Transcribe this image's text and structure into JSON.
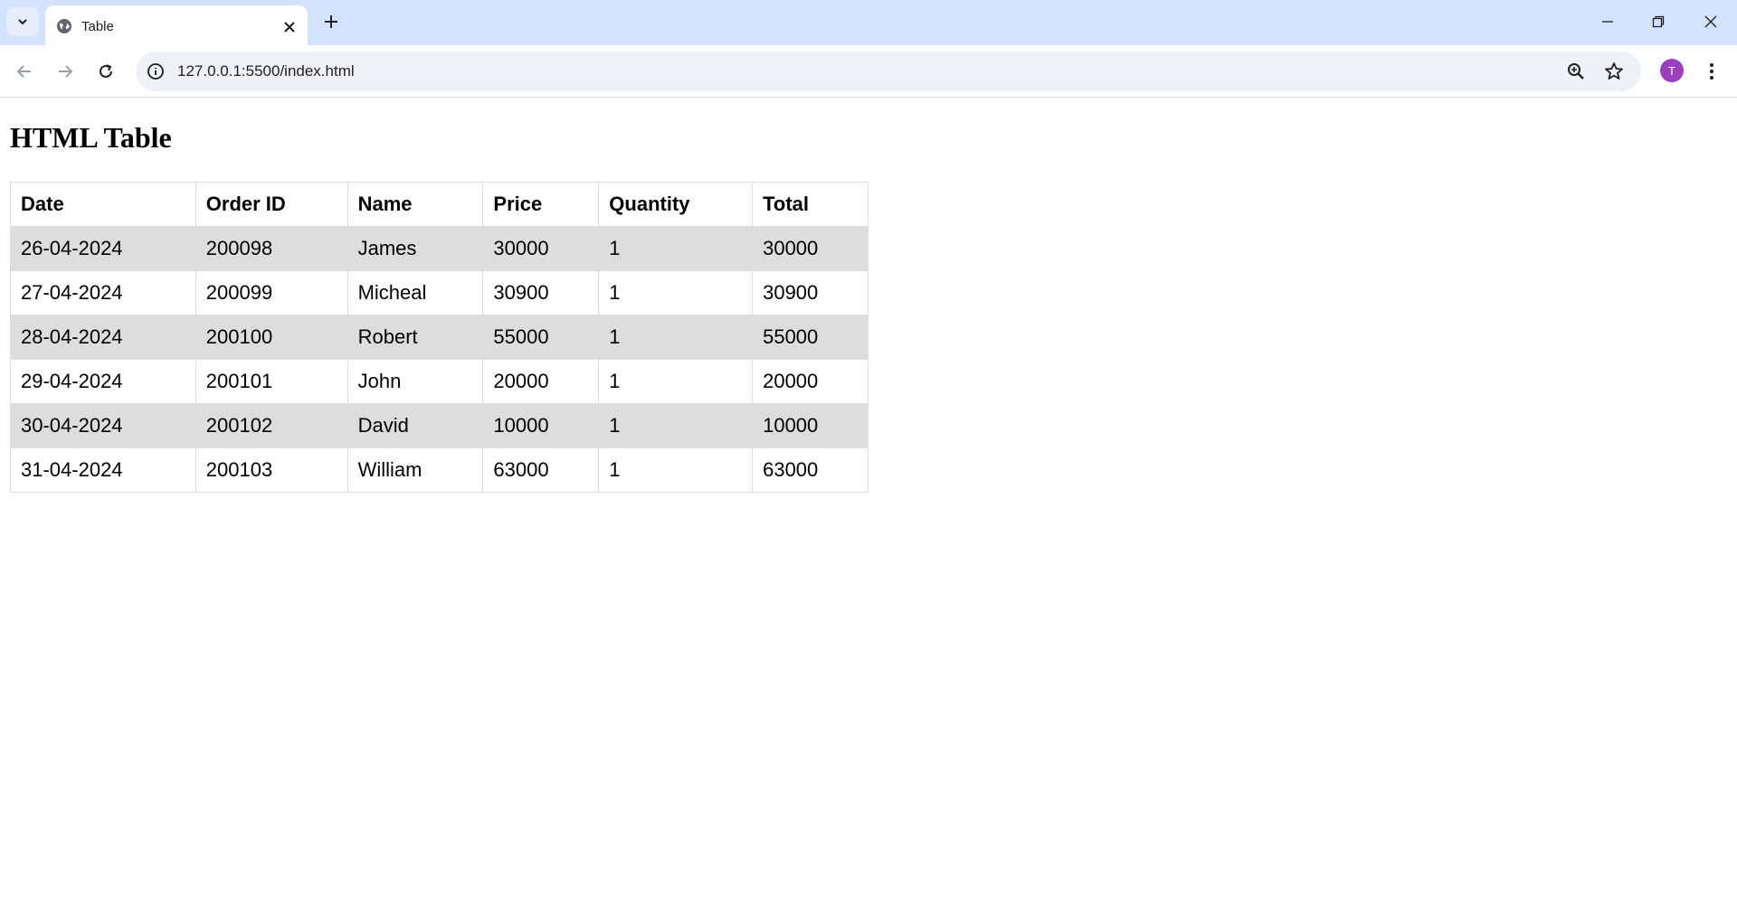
{
  "browser": {
    "tab_title": "Table",
    "url": "127.0.0.1:5500/index.html",
    "profile_initial": "T"
  },
  "page": {
    "heading": "HTML Table",
    "table": {
      "headers": [
        "Date",
        "Order ID",
        "Name",
        "Price",
        "Quantity",
        "Total"
      ],
      "rows": [
        [
          "26-04-2024",
          "200098",
          "James",
          "30000",
          "1",
          "30000"
        ],
        [
          "27-04-2024",
          "200099",
          "Micheal",
          "30900",
          "1",
          "30900"
        ],
        [
          "28-04-2024",
          "200100",
          "Robert",
          "55000",
          "1",
          "55000"
        ],
        [
          "29-04-2024",
          "200101",
          "John",
          "20000",
          "1",
          "20000"
        ],
        [
          "30-04-2024",
          "200102",
          "David",
          "10000",
          "1",
          "10000"
        ],
        [
          "31-04-2024",
          "200103",
          "William",
          "63000",
          "1",
          "63000"
        ]
      ]
    }
  },
  "icons": {
    "tab_search": "chevron-down-icon",
    "favicon": "globe-icon",
    "tab_close": "close-icon",
    "new_tab": "plus-icon",
    "minimize": "minimize-icon",
    "restore": "restore-icon",
    "close_window": "close-icon",
    "back": "arrow-left-icon",
    "forward": "arrow-right-icon",
    "reload": "reload-icon",
    "site_info": "info-icon",
    "zoom": "zoom-icon",
    "bookmark": "star-icon",
    "menu": "kebab-icon"
  },
  "colors": {
    "chrome_bg": "#d3e3fd",
    "omnibox_bg": "#eef1f8",
    "avatar_bg": "#9c3fbe",
    "stripe_row": "#dddddd",
    "border": "#dddddd"
  }
}
